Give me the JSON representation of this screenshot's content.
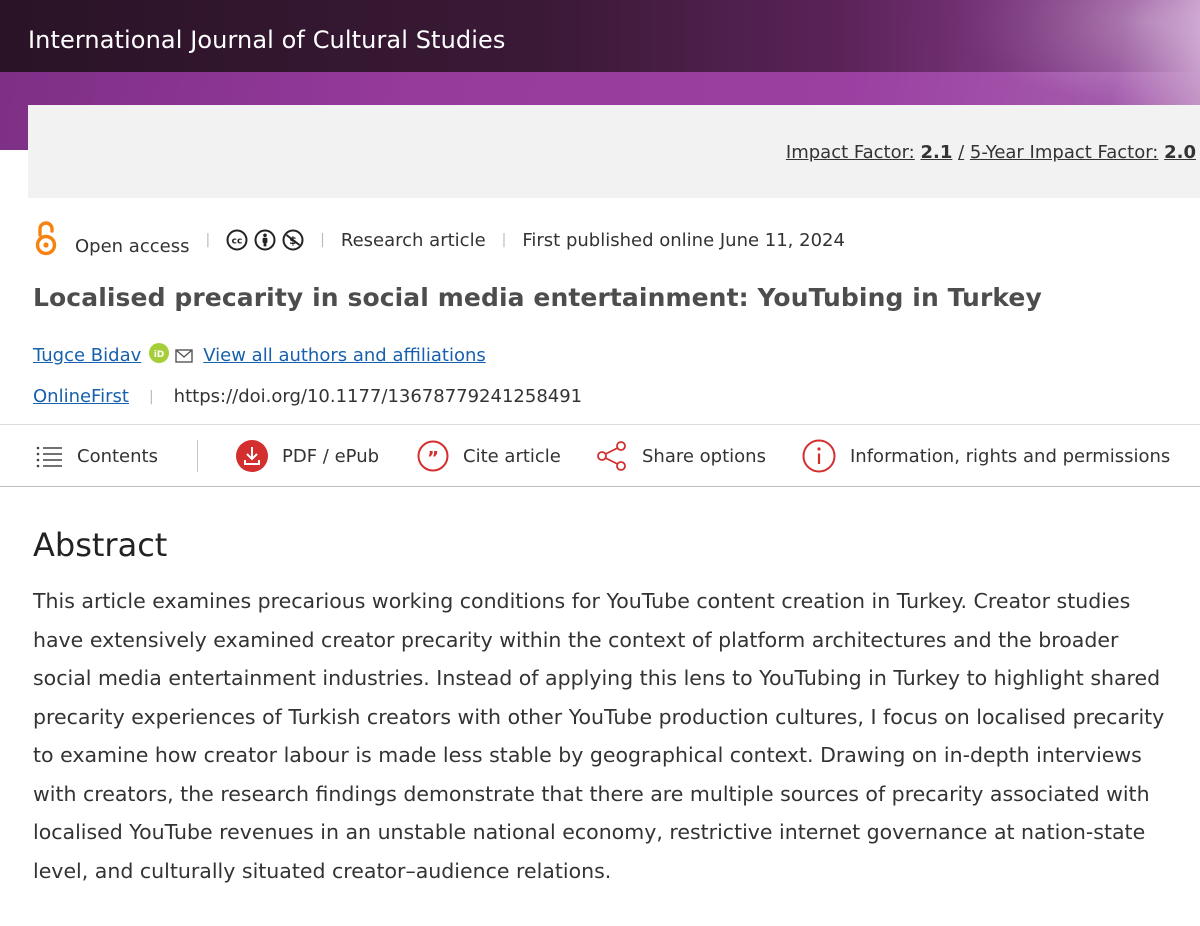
{
  "journal": {
    "title": "International Journal of Cultural Studies",
    "brand_color": "#9b3fa1",
    "impact_factor_label": "Impact Factor:",
    "impact_factor_value": "2.1",
    "five_year_label": "5-Year Impact Factor:",
    "five_year_value": "2.0",
    "impact_separator": "/"
  },
  "meta": {
    "open_access_icon": "open-access-lock-icon",
    "open_access_label": "Open access",
    "license_icons": [
      "cc-icon",
      "by-icon",
      "nc-icon"
    ],
    "article_type": "Research article",
    "published": "First published online June 11, 2024"
  },
  "article": {
    "title": "Localised precarity in social media entertainment: YouTubing in Turkey",
    "author": "Tugce Bidav",
    "authors_link": "View all authors and affiliations",
    "online_first": "OnlineFirst",
    "doi": "https://doi.org/10.1177/13678779241258491"
  },
  "toolbar": {
    "contents": "Contents",
    "pdf": "PDF / ePub",
    "cite": "Cite article",
    "share": "Share options",
    "info": "Information, rights and permissions",
    "accent_color": "#d32f2f"
  },
  "abstract": {
    "heading": "Abstract",
    "text": "This article examines precarious working conditions for YouTube content creation in Turkey. Creator studies have extensively examined creator precarity within the context of platform architectures and the broader social media entertainment industries. Instead of applying this lens to YouTubing in Turkey to highlight shared precarity experiences of Turkish creators with other YouTube production cultures, I focus on localised precarity to examine how creator labour is made less stable by geographical context. Drawing on in-depth interviews with creators, the research findings demonstrate that there are multiple sources of precarity associated with localised YouTube revenues in an unstable national economy, restrictive internet governance at nation-state level, and culturally situated creator–audience relations."
  }
}
